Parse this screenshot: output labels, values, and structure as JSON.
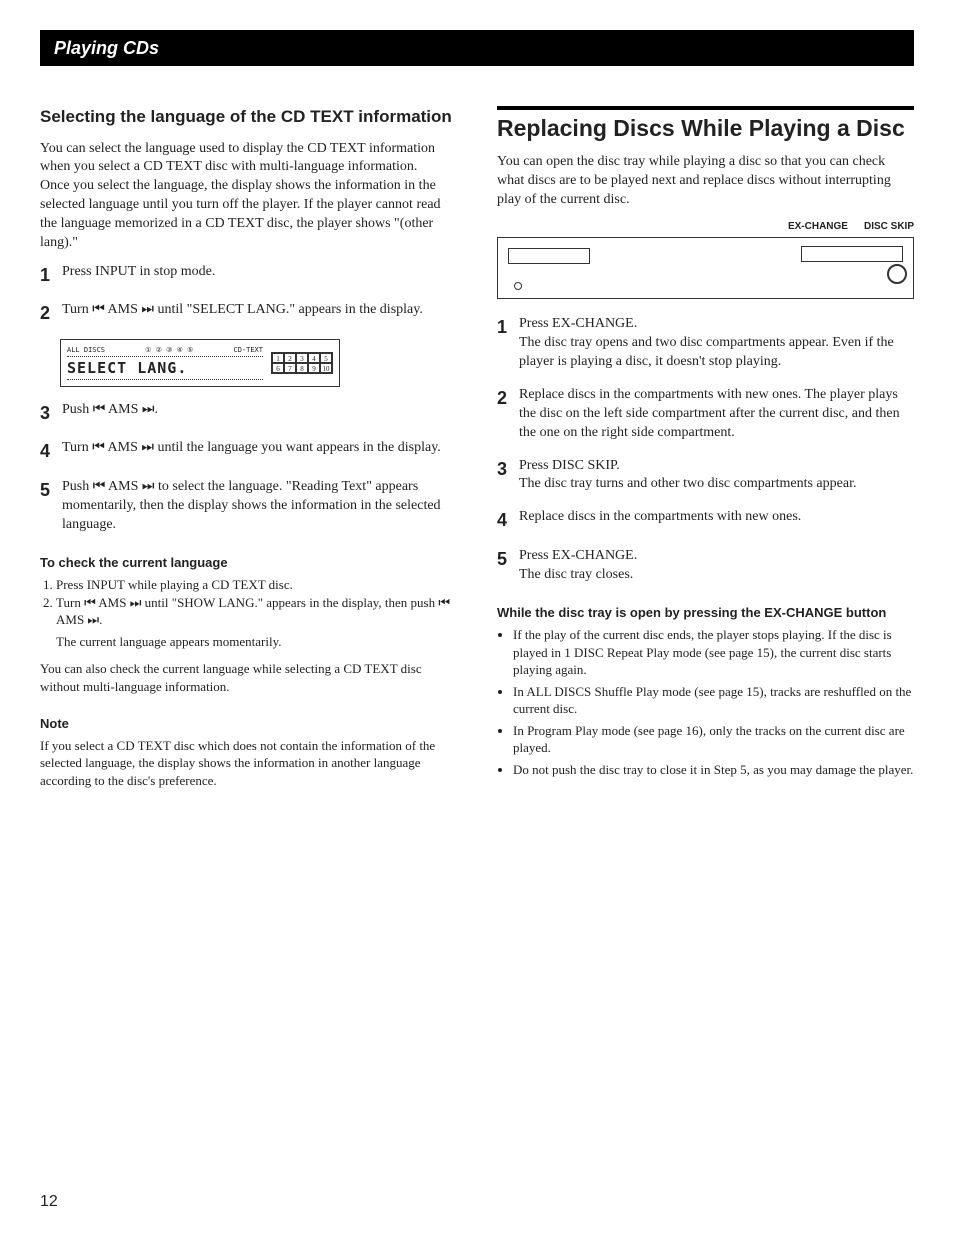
{
  "header": "Playing CDs",
  "page_number": "12",
  "left": {
    "heading": "Selecting the language of the CD TEXT information",
    "intro": "You can select the language used to display the CD TEXT information when you select a CD TEXT disc with multi-language information.\nOnce you select the language, the display shows the information in the selected language until you turn off the player. If the player cannot read the language memorized in a CD TEXT disc, the player shows \"(other lang).\"",
    "steps": [
      "Press INPUT in stop mode.",
      "Turn ⏮ AMS ⏭ until \"SELECT LANG.\" appears in the display.",
      "Push ⏮ AMS ⏭.",
      "Turn ⏮ AMS ⏭ until the language you want appears in the display.",
      "Push ⏮ AMS ⏭ to select the language. \"Reading Text\" appears momentarily, then the display shows the information in the selected language."
    ],
    "display": {
      "all_discs": "ALL DISCS",
      "discs": "① ② ③ ④ ⑤",
      "cd_text": "CD-TEXT",
      "main": "SELECT  LANG.",
      "grid": [
        "1",
        "2",
        "3",
        "4",
        "5",
        "6",
        "7",
        "8",
        "9",
        "10"
      ]
    },
    "check_heading": "To check the current language",
    "check_steps": [
      "Press INPUT while playing a CD TEXT disc.",
      "Turn ⏮ AMS ⏭ until \"SHOW LANG.\" appears in the display, then push ⏮ AMS ⏭."
    ],
    "check_tail1": "The current language appears momentarily.",
    "check_tail2": "You can also check the current language while selecting a CD TEXT disc without multi-language information.",
    "note_heading": "Note",
    "note_body": "If you select a CD TEXT disc which does not contain the information of the selected language, the display shows the information in another language according to the disc's preference."
  },
  "right": {
    "heading": "Replacing Discs While Playing a Disc",
    "intro": "You can open the disc tray while playing a disc so that you can check what discs are to be played next and replace discs without interrupting play of the current disc.",
    "labels": {
      "exchange": "EX-CHANGE",
      "disc_skip": "DISC SKIP"
    },
    "steps": [
      "Press EX-CHANGE.\nThe disc tray opens and two disc compartments appear. Even if the player is playing a disc, it doesn't stop playing.",
      "Replace discs in the compartments with new ones. The player plays the disc on the left side compartment after the current disc, and then the one on the right side compartment.",
      "Press DISC SKIP.\nThe disc tray turns and other two disc compartments appear.",
      "Replace discs in the compartments with new ones.",
      "Press EX-CHANGE.\nThe disc tray closes."
    ],
    "while_heading": "While the disc tray is open by pressing the EX-CHANGE button",
    "while_bullets": [
      "If the play of the current disc ends, the player stops playing. If the disc is played in 1 DISC Repeat Play mode (see page 15), the current disc starts playing again.",
      "In ALL DISCS Shuffle Play mode (see page 15), tracks are reshuffled on the current disc.",
      "In Program Play mode (see page 16), only the tracks on the current disc are played.",
      "Do not push the disc tray to close it in Step 5, as you may damage the player."
    ]
  }
}
